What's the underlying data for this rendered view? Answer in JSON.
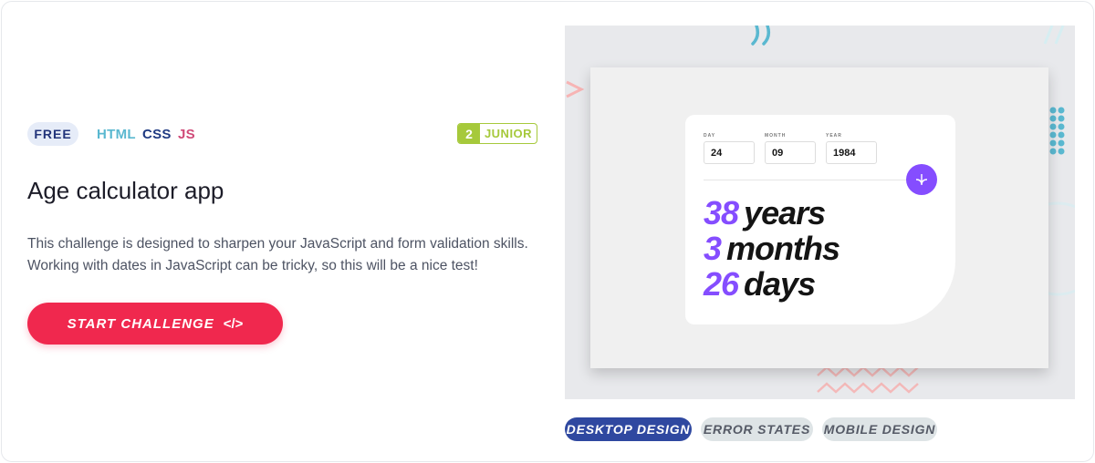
{
  "challenge": {
    "price_tag": "FREE",
    "languages": [
      "HTML",
      "CSS",
      "JS"
    ],
    "level_number": "2",
    "level_name": "JUNIOR",
    "title": "Age calculator app",
    "description": "This challenge is designed to sharpen your JavaScript and form validation skills. Working with dates in JavaScript can be tricky, so this will be a nice test!",
    "start_label": "START CHALLENGE",
    "start_icon": "</>"
  },
  "preview": {
    "fields": [
      {
        "label": "DAY",
        "value": "24"
      },
      {
        "label": "MONTH",
        "value": "09"
      },
      {
        "label": "YEAR",
        "value": "1984"
      }
    ],
    "results": [
      {
        "number": "38",
        "unit": "years"
      },
      {
        "number": "3",
        "unit": "months"
      },
      {
        "number": "26",
        "unit": "days"
      }
    ],
    "accent_color": "#854dff"
  },
  "design_tabs": [
    {
      "label": "DESKTOP DESIGN"
    },
    {
      "label": "ERROR STATES"
    },
    {
      "label": "MOBILE DESIGN"
    }
  ],
  "colors": {
    "primary_button": "#f0284e",
    "level_green": "#a6c93b",
    "active_tab": "#2f48a0"
  }
}
